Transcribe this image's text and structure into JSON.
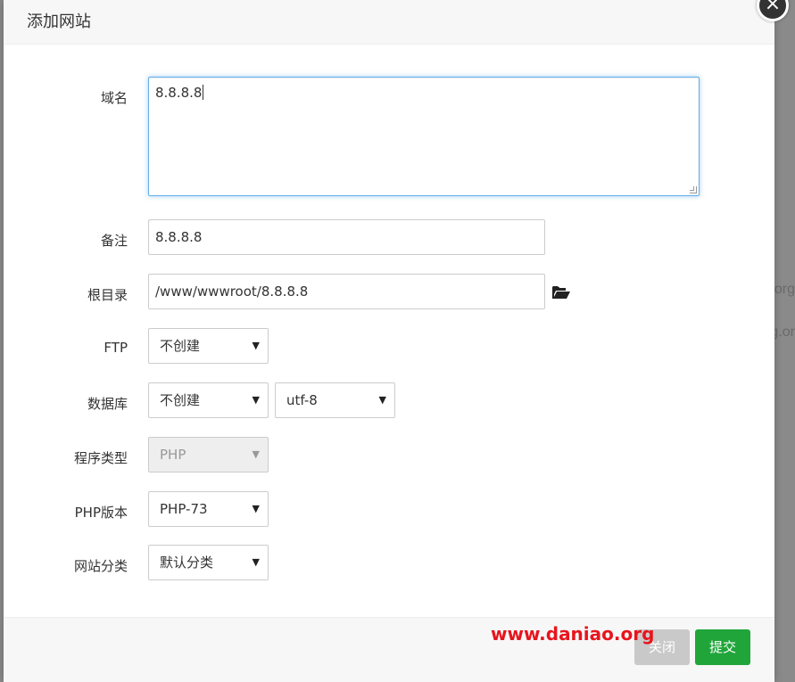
{
  "dialog": {
    "title": "添加网站",
    "close_icon": "×"
  },
  "form": {
    "domain": {
      "label": "域名",
      "value": "8.8.8.8"
    },
    "remark": {
      "label": "备注",
      "value": "8.8.8.8"
    },
    "root": {
      "label": "根目录",
      "value": "/www/wwwroot/8.8.8.8"
    },
    "ftp": {
      "label": "FTP",
      "selected": "不创建"
    },
    "database": {
      "label": "数据库",
      "selected": "不创建",
      "charset": "utf-8"
    },
    "program_type": {
      "label": "程序类型",
      "selected": "PHP"
    },
    "php_version": {
      "label": "PHP版本",
      "selected": "PHP-73"
    },
    "category": {
      "label": "网站分类",
      "selected": "默认分类"
    }
  },
  "footer": {
    "close_label": "关闭",
    "submit_label": "提交"
  },
  "watermark": "www.daniao.org",
  "background": {
    "right_text_1": ".org",
    "right_text_2": "g.or"
  },
  "colors": {
    "submit_green": "#20a53a",
    "focus_blue": "#66afe9",
    "watermark_red": "#e8141c"
  },
  "icons": {
    "select_arrow": "▼",
    "folder": "folder-open-icon"
  }
}
